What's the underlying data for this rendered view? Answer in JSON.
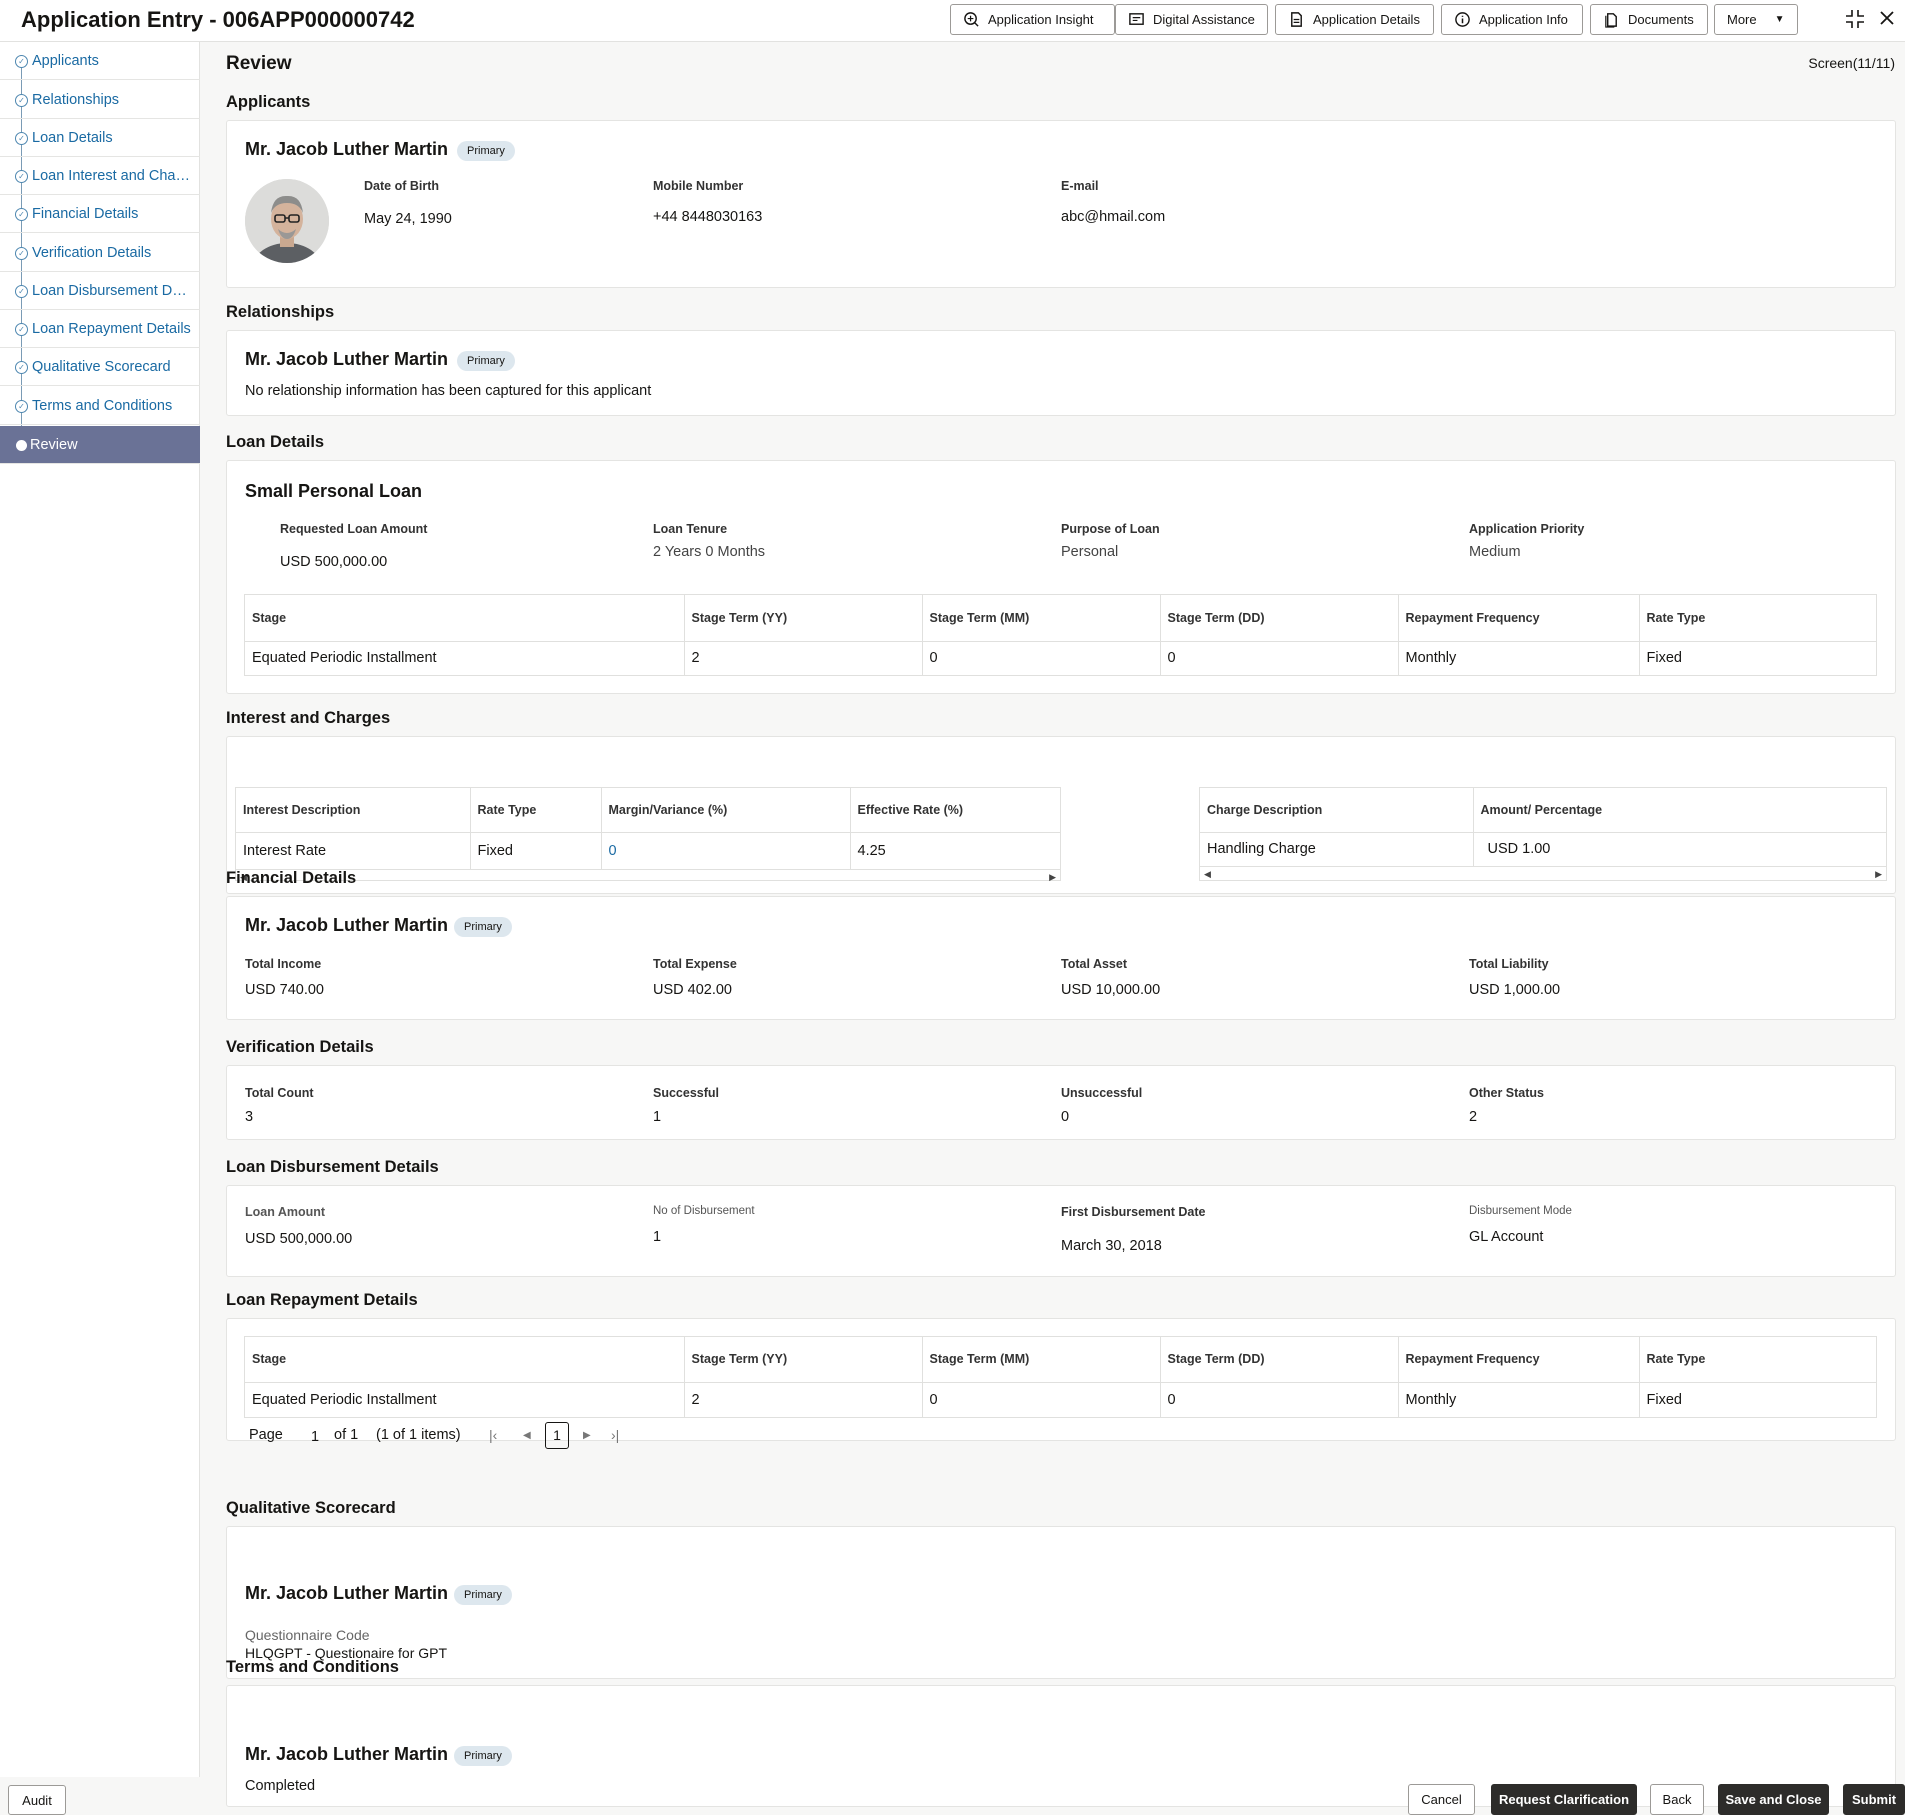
{
  "header": {
    "title": "Application Entry - 006APP000000742",
    "buttons": {
      "insight": "Application Insight",
      "assist": "Digital Assistance",
      "details": "Application Details",
      "info": "Application Info",
      "documents": "Documents",
      "more": "More"
    }
  },
  "sidebar": {
    "items": [
      {
        "label": "Applicants"
      },
      {
        "label": "Relationships"
      },
      {
        "label": "Loan Details"
      },
      {
        "label": "Loan Interest and Charges"
      },
      {
        "label": "Financial Details"
      },
      {
        "label": "Verification Details"
      },
      {
        "label": "Loan Disbursement Details"
      },
      {
        "label": "Loan Repayment Details"
      },
      {
        "label": "Qualitative Scorecard"
      },
      {
        "label": "Terms and Conditions"
      },
      {
        "label": "Review"
      }
    ]
  },
  "main": {
    "title": "Review",
    "screen": "Screen(11/11)",
    "primary_badge": "Primary",
    "applicants": {
      "section": "Applicants",
      "name": "Mr. Jacob Luther Martin",
      "dob_label": "Date of Birth",
      "dob": "May 24, 1990",
      "mobile_label": "Mobile Number",
      "mobile": "+44 8448030163",
      "email_label": "E-mail",
      "email": "abc@hmail.com"
    },
    "relationships": {
      "section": "Relationships",
      "name": "Mr. Jacob Luther Martin",
      "note": "No relationship information has been captured for this applicant"
    },
    "loan": {
      "section": "Loan Details",
      "product": "Small Personal Loan",
      "amount_label": "Requested Loan Amount",
      "amount": "USD 500,000.00",
      "tenure_label": "Loan Tenure",
      "tenure": "2 Years 0 Months",
      "purpose_label": "Purpose of Loan",
      "purpose": "Personal",
      "priority_label": "Application Priority",
      "priority": "Medium",
      "headers": [
        "Stage",
        "Stage Term (YY)",
        "Stage Term (MM)",
        "Stage Term (DD)",
        "Repayment Frequency",
        "Rate Type"
      ],
      "row": [
        "Equated Periodic Installment",
        "2",
        "0",
        "0",
        "Monthly",
        "Fixed"
      ]
    },
    "interest": {
      "section": "Interest and Charges",
      "headers": [
        "Interest Description",
        "Rate Type",
        "Margin/Variance (%)",
        "Effective Rate (%)"
      ],
      "row": [
        "Interest Rate",
        "Fixed",
        "0",
        "4.25"
      ],
      "charge_headers": [
        "Charge Description",
        "Amount/ Percentage"
      ],
      "charge_row": [
        "Handling Charge",
        "USD 1.00"
      ]
    },
    "financial": {
      "section": "Financial Details",
      "name": "Mr. Jacob Luther Martin",
      "income_label": "Total Income",
      "income": "USD 740.00",
      "expense_label": "Total Expense",
      "expense": "USD 402.00",
      "asset_label": "Total Asset",
      "asset": "USD 10,000.00",
      "liability_label": "Total Liability",
      "liability": "USD 1,000.00"
    },
    "verification": {
      "section": "Verification Details",
      "total_label": "Total Count",
      "total": "3",
      "success_label": "Successful",
      "success": "1",
      "fail_label": "Unsuccessful",
      "fail": "0",
      "other_label": "Other Status",
      "other": "2"
    },
    "disbursement": {
      "section": "Loan Disbursement Details",
      "amount_label": "Loan Amount",
      "amount": "USD 500,000.00",
      "count_label": "No of Disbursement",
      "count": "1",
      "date_label": "First Disbursement Date",
      "date": "March 30, 2018",
      "mode_label": "Disbursement Mode",
      "mode": "GL Account"
    },
    "repayment": {
      "section": "Loan Repayment Details",
      "headers": [
        "Stage",
        "Stage Term (YY)",
        "Stage Term (MM)",
        "Stage Term (DD)",
        "Repayment Frequency",
        "Rate Type"
      ],
      "row": [
        "Equated Periodic Installment",
        "2",
        "0",
        "0",
        "Monthly",
        "Fixed"
      ],
      "page_label": "Page",
      "page_num": "1",
      "of_label": "of 1",
      "items": "(1 of 1 items)",
      "current": "1"
    },
    "scorecard": {
      "section": "Qualitative Scorecard",
      "name": "Mr. Jacob Luther Martin",
      "code_label": "Questionnaire Code",
      "code": "HLQGPT - Questionaire for GPT"
    },
    "terms": {
      "section": "Terms and Conditions",
      "name": "Mr. Jacob Luther Martin",
      "status": "Completed"
    }
  },
  "footer": {
    "audit": "Audit",
    "cancel": "Cancel",
    "clarify": "Request Clarification",
    "back": "Back",
    "save_close": "Save and Close",
    "submit": "Submit"
  }
}
